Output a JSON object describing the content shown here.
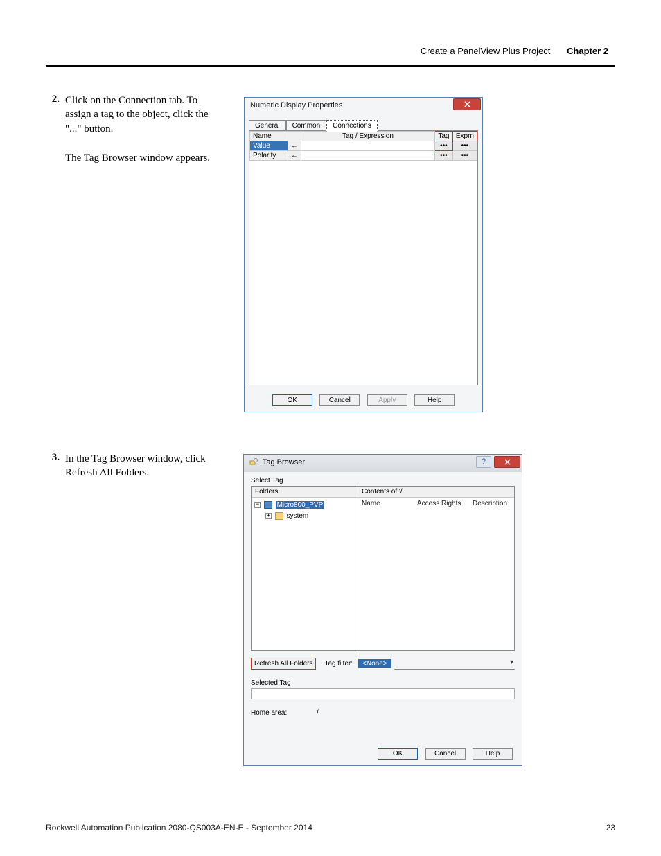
{
  "header": {
    "title": "Create a PanelView Plus Project",
    "chapter": "Chapter 2"
  },
  "steps": {
    "s2_num": "2.",
    "s2_text": "Click on the Connection tab. To assign a tag to the object, click the \"...\" button.",
    "s2_sub": "The Tag Browser window appears.",
    "s3_num": "3.",
    "s3_text": "In the Tag Browser window, click Refresh All Folders."
  },
  "dlg1": {
    "title": "Numeric Display Properties",
    "tabs": {
      "general": "General",
      "common": "Common",
      "connections": "Connections"
    },
    "cols": {
      "name": "Name",
      "tagexpr": "Tag / Expression",
      "tag": "Tag",
      "exprn": "Exprn"
    },
    "rows": {
      "value": "Value",
      "polarity": "Polarity",
      "arrow": "←",
      "ellipsis": "•••"
    },
    "buttons": {
      "ok": "OK",
      "cancel": "Cancel",
      "apply": "Apply",
      "help": "Help"
    }
  },
  "dlg2": {
    "title": "Tag Browser",
    "select_tag": "Select Tag",
    "folders": "Folders",
    "contents": "Contents of '/'",
    "cols": {
      "name": "Name",
      "access": "Access Rights",
      "desc": "Description"
    },
    "tree": {
      "root": "Micro800_PVP",
      "child": "system"
    },
    "refresh": "Refresh All Folders",
    "tag_filter_label": "Tag filter:",
    "tag_filter_value": "<None>",
    "selected_tag": "Selected Tag",
    "home_area_label": "Home area:",
    "home_area_value": "/",
    "buttons": {
      "ok": "OK",
      "cancel": "Cancel",
      "help": "Help"
    },
    "help_icon": "?"
  },
  "footer": {
    "pub": "Rockwell Automation Publication 2080-QS003A-EN-E - September 2014",
    "page": "23"
  }
}
